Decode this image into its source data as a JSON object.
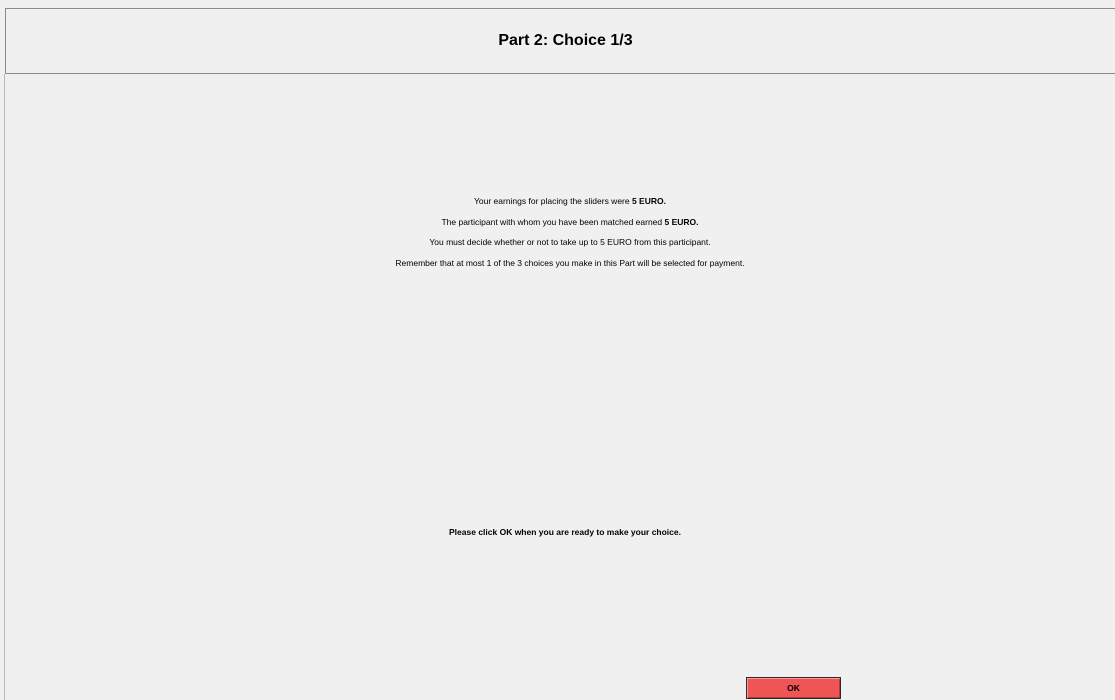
{
  "header": {
    "title": "Part 2: Choice 1/3"
  },
  "info": {
    "line1_prefix": "Your earnings for placing the sliders were ",
    "line1_bold": "5 EURO.",
    "line2_prefix": "The participant with whom you have been matched earned ",
    "line2_bold": "5 EURO.",
    "line3": "You must decide whether or not to take up to 5 EURO from this participant.",
    "line4": "Remember that at most 1 of the 3 choices you make in this Part will be selected for payment."
  },
  "prompt": "Please click OK when you are ready to make your choice.",
  "ok_button": {
    "label": "OK",
    "color": "#f05555"
  }
}
